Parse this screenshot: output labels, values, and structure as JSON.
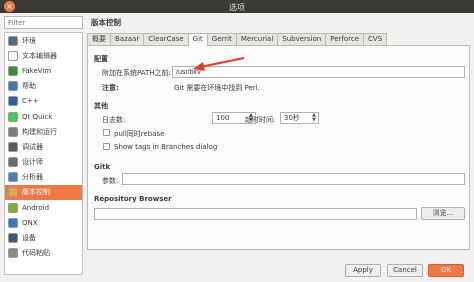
{
  "window": {
    "title": "选项"
  },
  "sidebar": {
    "filter_placeholder": "Filter",
    "items": [
      {
        "label": "环境",
        "color": "#4f6b8c"
      },
      {
        "label": "文本编辑器",
        "color": "#ffffff"
      },
      {
        "label": "FakeVim",
        "color": "#3d8f3d"
      },
      {
        "label": "帮助",
        "color": "#3a78c2"
      },
      {
        "label": "C++",
        "color": "#2b5fa8"
      },
      {
        "label": "Qt Quick",
        "color": "#41cd52"
      },
      {
        "label": "构建和运行",
        "color": "#7b7b7b"
      },
      {
        "label": "调试器",
        "color": "#5b5b5b"
      },
      {
        "label": "设计师",
        "color": "#6c6c6c"
      },
      {
        "label": "分析器",
        "color": "#4c7dc3"
      },
      {
        "label": "版本控制",
        "color": "#e9a23b"
      },
      {
        "label": "Android",
        "color": "#7bb32e"
      },
      {
        "label": "QNX",
        "color": "#2f7ac0"
      },
      {
        "label": "设备",
        "color": "#3d5a7a"
      },
      {
        "label": "代码粘贴",
        "color": "#8a8a8a"
      }
    ],
    "selected_index": 10
  },
  "main": {
    "title": "版本控制",
    "tabs": [
      "概要",
      "Bazaar",
      "ClearCase",
      "Git",
      "Gerrit",
      "Mercurial",
      "Subversion",
      "Perforce",
      "CVS"
    ],
    "active_tab": "Git",
    "config": {
      "heading": "配置",
      "path_label": "附加在系统PATH之前:",
      "path_value": "/usr/bin/",
      "note_label": "注意:",
      "note_text": "Git 需要在环境中找到 Perl."
    },
    "misc": {
      "heading": "其他",
      "log_label": "日志数:",
      "log_value": "100",
      "timeout_label": "超时时间:",
      "timeout_value": "30秒",
      "pull_rebase_label": "pull同时rebase",
      "show_tags_label": "Show tags in Branches dialog"
    },
    "gitk": {
      "heading": "Gitk",
      "args_label": "参数:",
      "args_value": ""
    },
    "repo_browser": {
      "heading": "Repository Browser",
      "path_value": "",
      "browse_label": "浏览..."
    }
  },
  "footer": {
    "apply_label": "Apply",
    "cancel_label": "Cancel",
    "ok_label": "OK"
  }
}
